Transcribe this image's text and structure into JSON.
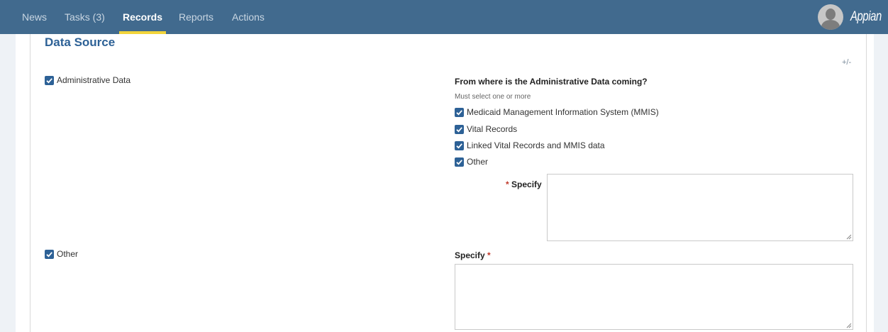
{
  "nav": {
    "items": [
      {
        "label": "News",
        "active": false
      },
      {
        "label": "Tasks (3)",
        "active": false
      },
      {
        "label": "Records",
        "active": true
      },
      {
        "label": "Reports",
        "active": false
      },
      {
        "label": "Actions",
        "active": false
      }
    ],
    "brand": "Appian"
  },
  "section": {
    "title": "Data Source",
    "toggle": "+/-"
  },
  "left_options": [
    {
      "label": "Administrative Data",
      "checked": true
    },
    {
      "label": "Other",
      "checked": true
    }
  ],
  "admin_source": {
    "question": "From where is the Administrative Data coming?",
    "hint": "Must select one or more",
    "options": [
      {
        "label": "Medicaid Management Information System (MMIS)",
        "checked": true
      },
      {
        "label": "Vital Records",
        "checked": true
      },
      {
        "label": "Linked Vital Records and MMIS data",
        "checked": true
      },
      {
        "label": "Other",
        "checked": true
      }
    ],
    "specify_label": "Specify",
    "specify_required_mark": "*",
    "specify_value": ""
  },
  "other_specify": {
    "label": "Specify",
    "required_mark": "*",
    "value": ""
  },
  "colors": {
    "topbar": "#416a8e",
    "nav_active_underline": "#f2d43b",
    "checkbox": "#2d6196",
    "section_title": "#2d6196",
    "required": "#c0392b"
  }
}
